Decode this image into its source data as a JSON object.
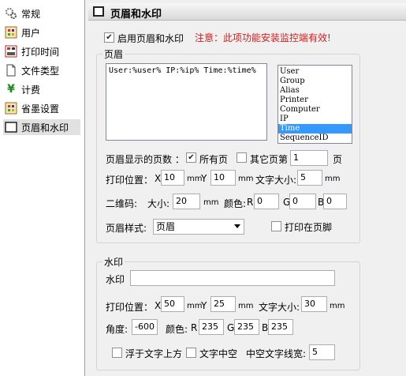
{
  "sidebar": {
    "items": [
      {
        "label": "常规",
        "icon": "gears-icon"
      },
      {
        "label": "用户",
        "icon": "user-icon"
      },
      {
        "label": "打印时间",
        "icon": "print-time-icon"
      },
      {
        "label": "文件类型",
        "icon": "document-icon"
      },
      {
        "label": "计费",
        "icon": "yen-icon"
      },
      {
        "label": "省墨设置",
        "icon": "ink-icon"
      },
      {
        "label": "页眉和水印",
        "icon": "header-watermark-icon"
      }
    ],
    "selected_index": 6
  },
  "header": {
    "title": "页眉和水印"
  },
  "enable": {
    "label": "启用页眉和水印",
    "checked": true,
    "warning": "注意：此项功能安装监控端有效!"
  },
  "header_group": {
    "legend": "页眉",
    "template_text": "User:%user% IP:%ip% Time:%time%",
    "variables": [
      "User",
      "Group",
      "Alias",
      "Printer",
      "Computer",
      "IP",
      "Time",
      "SequenceID"
    ],
    "selected_variable": "Time",
    "pages_label": "页眉显示的页数 ：",
    "all_pages_label": "所有页",
    "all_pages_checked": true,
    "other_pages_label": "其它页第",
    "other_pages_checked": false,
    "other_pages_value": "1",
    "page_unit": "页",
    "position_label": "打印位置：",
    "x_label": "X",
    "x_value": "10",
    "y_label": "Y",
    "y_value": "10",
    "unit_mm": "mm",
    "font_size_label": "文字大小:",
    "font_size_value": "5",
    "qr_label": "二维码:",
    "qr_size_label": "大小:",
    "qr_size_value": "20",
    "color_label": "颜色:",
    "r_label": "R",
    "r_value": "0",
    "g_label": "G",
    "g_value": "0",
    "b_label": "B",
    "b_value": "0",
    "style_label": "页眉样式:",
    "style_value": "页眉",
    "footer_label": "打印在页脚",
    "footer_checked": false
  },
  "watermark_group": {
    "legend": "水印",
    "watermark_label": "水印",
    "watermark_value": "",
    "position_label": "打印位置：",
    "x_label": "X",
    "x_value": "50",
    "y_label": "Y",
    "y_value": "25",
    "unit_mm": "mm",
    "font_size_label": "文字大小:",
    "font_size_value": "30",
    "angle_label": "角度:",
    "angle_value": "-600",
    "color_label": "颜色:",
    "r_label": "R",
    "r_value": "235",
    "g_label": "G",
    "g_value": "235",
    "b_label": "B",
    "b_value": "235",
    "float_label": "浮于文字上方",
    "float_checked": false,
    "hollow_label": "文字中空",
    "hollow_checked": false,
    "hollow_width_label": "中空文字线宽:",
    "hollow_width_value": "5"
  },
  "colors": {
    "accent": "#3399ff",
    "warning": "#d02020"
  }
}
